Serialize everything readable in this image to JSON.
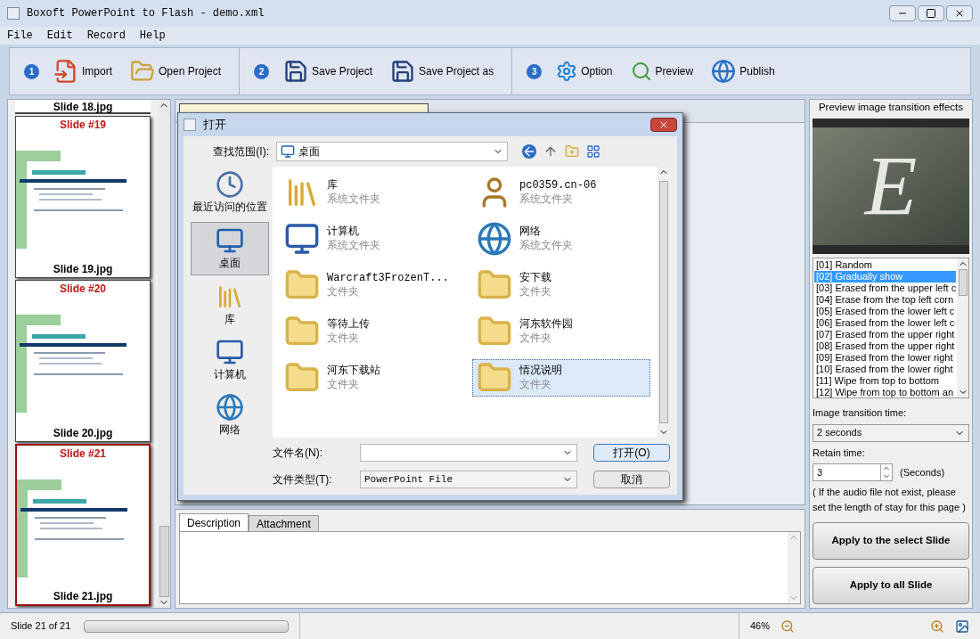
{
  "window": {
    "title": "Boxoft PowerPoint to Flash - demo.xml"
  },
  "menu": [
    "File",
    "Edit",
    "Record",
    "Help"
  ],
  "toolbar": [
    {
      "step": "1",
      "buttons": [
        {
          "label": "Import"
        },
        {
          "label": "Open Project"
        }
      ]
    },
    {
      "step": "2",
      "buttons": [
        {
          "label": "Save Project"
        },
        {
          "label": "Save Project as"
        }
      ]
    },
    {
      "step": "3",
      "buttons": [
        {
          "label": "Option"
        },
        {
          "label": "Preview"
        },
        {
          "label": "Publish"
        }
      ]
    }
  ],
  "slides": [
    {
      "caption": "Slide 18.jpg",
      "selected": false
    },
    {
      "heading": "Slide #19",
      "caption": "Slide 19.jpg",
      "selected": false
    },
    {
      "heading": "Slide #20",
      "caption": "Slide 20.jpg",
      "selected": false
    },
    {
      "heading": "Slide #21",
      "caption": "Slide 21.jpg",
      "selected": true
    }
  ],
  "dialog": {
    "title": "打开",
    "look_in_label": "查找范围(I):",
    "look_in_value": "桌面",
    "places": [
      {
        "label": "最近访问的位置",
        "kind": "recent",
        "selected": false
      },
      {
        "label": "桌面",
        "kind": "desktop",
        "selected": true
      },
      {
        "label": "库",
        "kind": "library",
        "selected": false
      },
      {
        "label": "计算机",
        "kind": "computer",
        "selected": false
      },
      {
        "label": "网络",
        "kind": "network",
        "selected": false
      }
    ],
    "files": [
      {
        "name": "库",
        "type": "系统文件夹",
        "kind": "library",
        "selected": false
      },
      {
        "name": "pc0359.cn-06",
        "type": "系统文件夹",
        "kind": "user",
        "selected": false
      },
      {
        "name": "计算机",
        "type": "系统文件夹",
        "kind": "computer",
        "selected": false
      },
      {
        "name": "网络",
        "type": "系统文件夹",
        "kind": "network",
        "selected": false
      },
      {
        "name": "Warcraft3FrozenT...",
        "type": "文件夹",
        "kind": "folder",
        "selected": false
      },
      {
        "name": "安下载",
        "type": "文件夹",
        "kind": "folder",
        "selected": false
      },
      {
        "name": "等待上传",
        "type": "文件夹",
        "kind": "folder",
        "selected": false
      },
      {
        "name": "河东软件园",
        "type": "文件夹",
        "kind": "folder",
        "selected": false
      },
      {
        "name": "河东下载站",
        "type": "文件夹",
        "kind": "folder",
        "selected": false
      },
      {
        "name": "情况说明",
        "type": "文件夹",
        "kind": "folder",
        "selected": true
      }
    ],
    "filename_label": "文件名(N):",
    "filetype_label": "文件类型(T):",
    "filetype_value": "PowerPoint File",
    "open_button": "打开(O)",
    "cancel_button": "取消"
  },
  "tabs": [
    {
      "label": "Description",
      "selected": true
    },
    {
      "label": "Attachment",
      "selected": false
    }
  ],
  "effects_panel": {
    "title": "Preview image transition effects",
    "preview_letter": "E",
    "effects": [
      {
        "label": "[01] Random",
        "selected": false
      },
      {
        "label": "[02] Gradually show",
        "selected": true
      },
      {
        "label": "[03] Erased from the upper left c",
        "selected": false
      },
      {
        "label": "[04] Erase from the top left corn",
        "selected": false
      },
      {
        "label": "[05] Erased from the lower left c",
        "selected": false
      },
      {
        "label": "[06] Erased from the lower left c",
        "selected": false
      },
      {
        "label": "[07] Erased from the upper right",
        "selected": false
      },
      {
        "label": "[08] Erased from the upper right",
        "selected": false
      },
      {
        "label": "[09] Erased from the lower right",
        "selected": false
      },
      {
        "label": "[10] Erased from the lower right",
        "selected": false
      },
      {
        "label": "[11] Wipe from top to bottom",
        "selected": false
      },
      {
        "label": "[12] Wipe from top to bottom an",
        "selected": false
      }
    ],
    "transition_label": "Image transition time:",
    "transition_value": "2 seconds",
    "retain_label": "Retain time:",
    "retain_value": "3",
    "retain_unit": "(Seconds)",
    "note": "( If the audio file not exist, please set the length of stay for this page )",
    "buttons": [
      "Apply to the select Slide",
      "Apply to all Slide"
    ]
  },
  "status_bar": {
    "slide_count": "Slide 21 of 21",
    "progress": {
      "level": 0
    },
    "zoom": "46%"
  }
}
